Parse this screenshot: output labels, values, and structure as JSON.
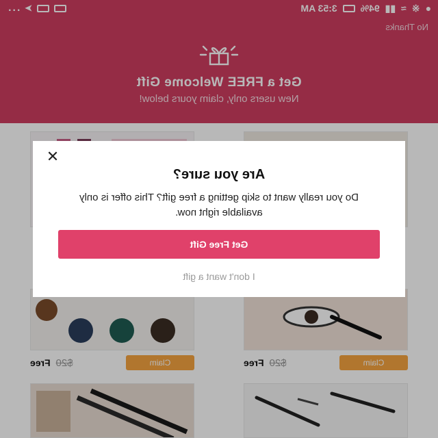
{
  "status_bar": {
    "time": "3:53 AM",
    "battery": "94%",
    "dots": "..."
  },
  "header": {
    "no_thanks": "No Thanks",
    "title": "Get a FREE Welcome Gift",
    "subtitle": "New users only, claim yours below!"
  },
  "products": [
    {
      "free_label": "Free",
      "old_price": "$20",
      "claim": "Claim"
    },
    {
      "free_label": "Free",
      "old_price": "$20",
      "claim": "Claim"
    }
  ],
  "dialog": {
    "title": "Are you sure?",
    "body": "Do you really want to skip getting a free gift? This offer is only available right now.",
    "primary_button": "Get Free Gift",
    "decline_link": "I don't want a gift"
  },
  "colors": {
    "brand": "#cf3d60",
    "primary_button": "#e0416a",
    "claim_button": "#f5a441"
  }
}
